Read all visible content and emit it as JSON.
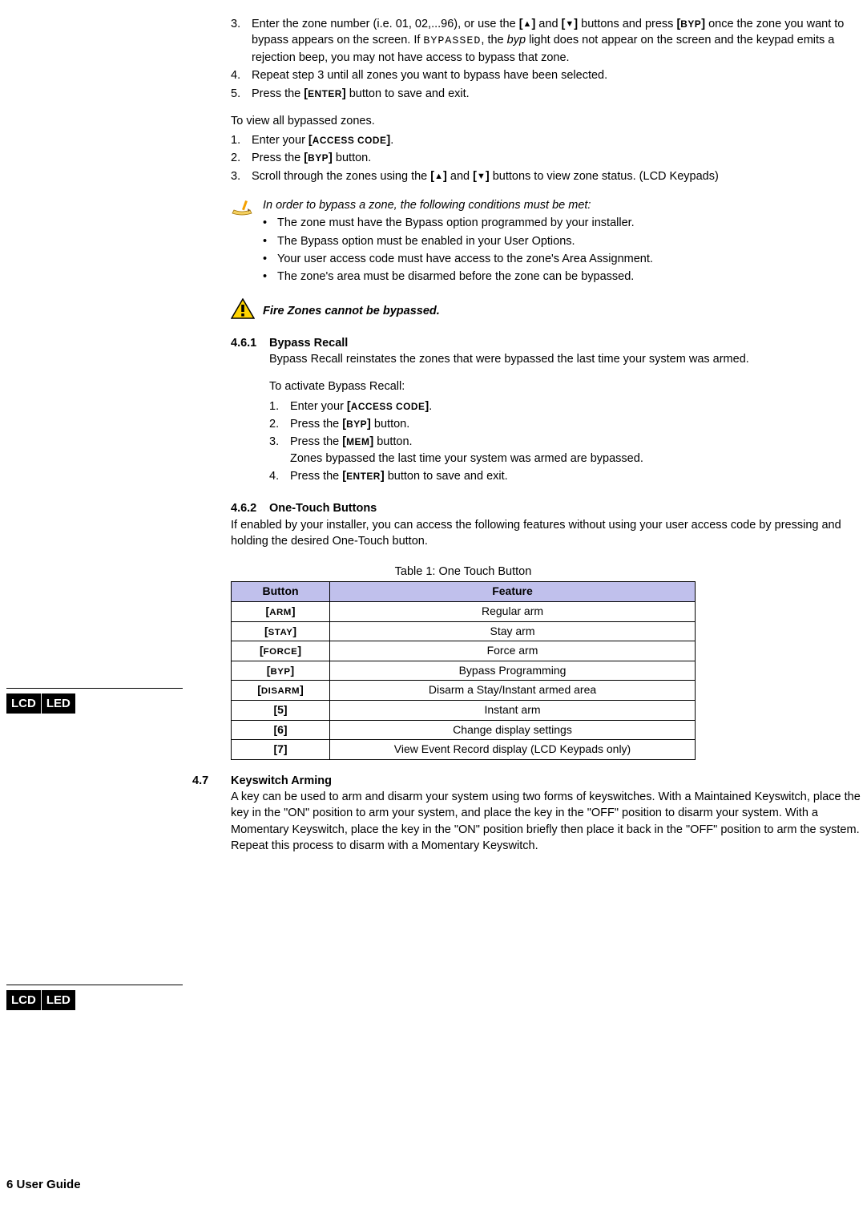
{
  "steps_a": {
    "3": {
      "pre": "Enter the zone number (i.e. 01, 02,...96), or use the ",
      "up": "[▲]",
      "mid1": " and ",
      "down": "[▼]",
      "mid2": " buttons and press ",
      "byp": "[BYP]",
      "mid3": " once the zone you want to bypass appears on the screen. If ",
      "bypassed": "BYPASSED",
      "mid4": ", the ",
      "byp_ital": "byp",
      "tail": " light does not appear on the screen and the keypad emits a rejection beep, you may not have access to bypass that zone."
    },
    "4": "Repeat step 3 until all zones you want to bypass have been selected.",
    "5": {
      "pre": "Press the ",
      "enter": "[ENTER]",
      "tail": " button to save and exit."
    }
  },
  "view_para": "To view all bypassed zones.",
  "steps_b": {
    "1": {
      "pre": "Enter your ",
      "ac": "[ACCESS CODE]",
      "tail": "."
    },
    "2": {
      "pre": "Press the ",
      "byp": "[BYP]",
      "tail": " button."
    },
    "3": {
      "pre": "Scroll through the zones using the ",
      "up": "[▲]",
      "mid": " and ",
      "down": "[▼]",
      "tail": " buttons to view zone status. (LCD Keypads)"
    }
  },
  "note": {
    "intro": "In order to bypass a zone, the following conditions must be met:",
    "bullets": [
      "The zone must have the Bypass option programmed by your installer.",
      "The Bypass option must be enabled in your User Options.",
      "Your user access code must have access to the zone's Area Assignment.",
      "The zone's area must be disarmed before the zone can be bypassed."
    ]
  },
  "warn": "Fire Zones cannot be bypassed.",
  "s461": {
    "num": "4.6.1",
    "title": "Bypass Recall",
    "p1": "Bypass Recall reinstates the zones that were bypassed the last time your system was armed.",
    "p2": "To activate Bypass Recall:",
    "steps": {
      "1": {
        "pre": "Enter your ",
        "ac": "[ACCESS CODE]",
        "tail": "."
      },
      "2": {
        "pre": "Press the ",
        "byp": "[BYP]",
        "tail": " button."
      },
      "3": {
        "pre": "Press the ",
        "mem": "[MEM]",
        "tail": " button.",
        "sub": "Zones bypassed the last time your system was armed are bypassed."
      },
      "4": {
        "pre": "Press the ",
        "enter": "[ENTER]",
        "tail": " button to save and exit."
      }
    }
  },
  "s462": {
    "num": "4.6.2",
    "title": "One-Touch Buttons",
    "p": "If enabled by your installer, you can access the following features without using your user access code by pressing and holding the desired One-Touch button."
  },
  "lcd": "LCD",
  "led": "LED",
  "table": {
    "caption": "Table 1: One Touch Button",
    "h1": "Button",
    "h2": "Feature",
    "rows": [
      {
        "b": "[ARM]",
        "f": "Regular arm"
      },
      {
        "b": "[STAY]",
        "f": "Stay arm"
      },
      {
        "b": "[FORCE]",
        "f": "Force arm"
      },
      {
        "b": "[BYP]",
        "f": "Bypass Programming"
      },
      {
        "b": "[DISARM]",
        "f": "Disarm a Stay/Instant armed area"
      },
      {
        "b": "[5]",
        "f": "Instant arm"
      },
      {
        "b": "[6]",
        "f": "Change display settings"
      },
      {
        "b": "[7]",
        "f": "View Event Record display (LCD Keypads only)"
      }
    ]
  },
  "s47": {
    "num": "4.7",
    "title": "Keyswitch Arming",
    "p": "A key can be used to arm and disarm your system using two forms of keyswitches. With a Maintained Keyswitch, place the key in the \"ON\" position to arm your system, and place the key in the \"OFF\" position to disarm your system. With a Momentary Keyswitch, place the key in the \"ON\" position briefly then place it back in the \"OFF\" position to arm the system. Repeat this process to disarm with a Momentary Keyswitch."
  },
  "footer": "6 User Guide"
}
